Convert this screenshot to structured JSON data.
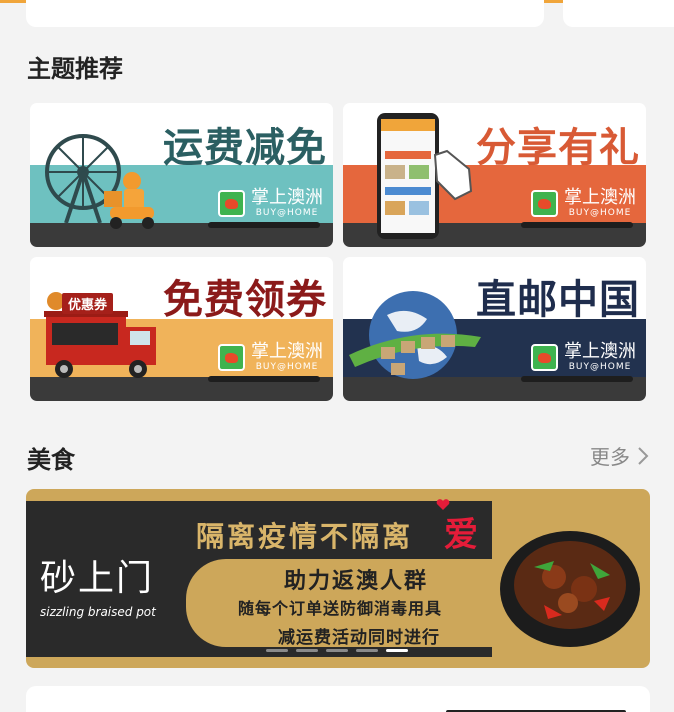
{
  "sections": {
    "theme": {
      "title": "主题推荐"
    },
    "food": {
      "title": "美食",
      "more_label": "更多"
    }
  },
  "brand_logo": {
    "cn": "掌上澳洲",
    "en": "BUY@HOME"
  },
  "tiles": [
    {
      "title": "运费减免",
      "title_color": "#2b5f62",
      "band_color": "#6ec1c0"
    },
    {
      "title": "分享有礼",
      "title_color": "#d85a35",
      "band_color": "#e5673d"
    },
    {
      "title": "免费领券",
      "title_color": "#8b1a1a",
      "band_color": "#f0b35a",
      "coupon_label": "优惠券"
    },
    {
      "title": "直邮中国",
      "title_color": "#1f2d4d",
      "band_color": "#22324f"
    }
  ],
  "food_banner": {
    "brand_cn": "砂上门",
    "brand_en": "sizzling braised pot",
    "line1": "隔离疫情不隔离",
    "line1_highlight": "爱",
    "line2": "助力返澳人群",
    "line3": "随每个订单送防御消毒用具",
    "line4": "减运费活动同时进行",
    "slide_count": 5,
    "active_slide": 5
  },
  "colors": {
    "accent_line": "#f0a53a",
    "banner_gold": "#cda75a"
  }
}
